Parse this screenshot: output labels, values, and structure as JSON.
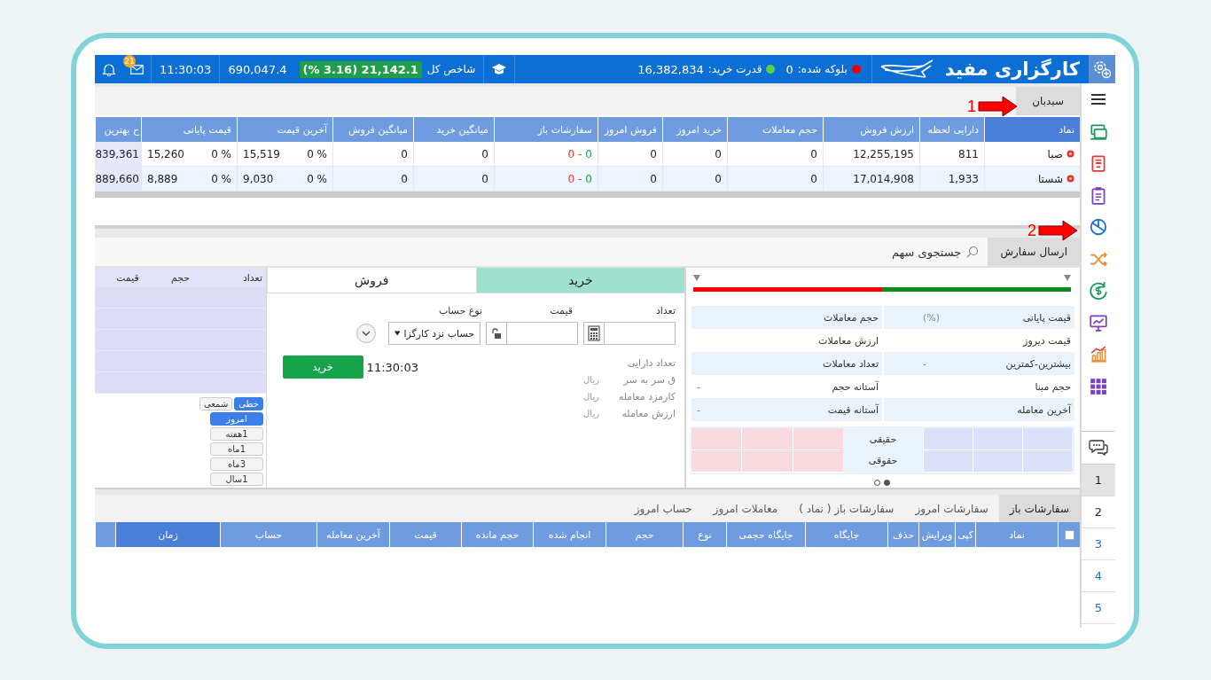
{
  "top_bar": {
    "logo": "کارگزاری مفید",
    "blocked": {
      "label": "بلوکه شده:",
      "value": "0"
    },
    "buying_power": {
      "label": "قدرت خرید:",
      "value": "16,382,834"
    },
    "index": {
      "label": "شاخص کل",
      "change": "(% 3.16) 21,142.1",
      "value": "690,047.4"
    },
    "time": "11:30:03",
    "mail_badge": "21"
  },
  "sidebar": {
    "tabs": [
      {
        "label": "1",
        "selected": true
      },
      {
        "label": "2",
        "selected": false
      },
      {
        "label": "3",
        "selected": false
      },
      {
        "label": "4",
        "selected": false
      },
      {
        "label": "5",
        "selected": false
      }
    ]
  },
  "watchlist": {
    "tabs": [
      {
        "label": "سبدبان",
        "selected": true
      }
    ],
    "columns": [
      {
        "label": "نماد",
        "kind": "symbol",
        "highlighted": true
      },
      {
        "label": "دارایی لحظه",
        "kind": "number",
        "highlighted": false
      },
      {
        "label": "ارزش فروش",
        "kind": "number",
        "highlighted": false
      },
      {
        "label": "حجم معاملات",
        "kind": "number",
        "highlighted": false
      },
      {
        "label": "خرید امروز",
        "kind": "number",
        "highlighted": false
      },
      {
        "label": "فروش امروز",
        "kind": "number",
        "highlighted": false
      },
      {
        "label": "سفارشات باز",
        "kind": "orders",
        "highlighted": false
      },
      {
        "label": "میانگین خرید",
        "kind": "number",
        "highlighted": false
      },
      {
        "label": "میانگین فروش",
        "kind": "number",
        "highlighted": false
      },
      {
        "label": "آخرین قیمت",
        "kind": "price",
        "highlighted": false
      },
      {
        "label": "قیمت پایانی",
        "kind": "price",
        "highlighted": false
      },
      {
        "label": "ح بهترین",
        "kind": "edge",
        "highlighted": false
      }
    ],
    "rows": [
      {
        "cells": [
          "صبا",
          "811",
          "12,255,195",
          "0",
          "0",
          "0",
          {
            "buy": "0",
            "separator": "-",
            "sell": "0"
          },
          "0",
          "0",
          {
            "percent": "0 %",
            "price": "15,519"
          },
          {
            "percent": "0 %",
            "price": "15,260"
          },
          "839,361"
        ]
      },
      {
        "cells": [
          "شستا",
          "1,933",
          "17,014,908",
          "0",
          "0",
          "0",
          {
            "buy": "0",
            "separator": "-",
            "sell": "0"
          },
          "0",
          "0",
          {
            "percent": "0 %",
            "price": "9,030"
          },
          {
            "percent": "0 %",
            "price": "8,889"
          },
          "889,660"
        ]
      }
    ]
  },
  "order_panel": {
    "tabs": [
      {
        "label": "ارسال سفارش",
        "selected": true
      }
    ],
    "search": {
      "placeholder": "جستجوی سهم"
    },
    "balance_bar": {
      "level": 0.5
    },
    "info": [
      {
        "right": {
          "label": "قیمت پایانی",
          "value": "(%)"
        },
        "left": {
          "label": "حجم معاملات"
        }
      },
      {
        "right": {
          "label": "قیمت دیروز"
        },
        "left": {
          "label": "ارزش معاملات"
        }
      },
      {
        "right": {
          "label": "بیشترین-کمترین",
          "value": "-"
        },
        "left": {
          "label": "تعداد معاملات"
        }
      },
      {
        "right": {
          "label": "حجم مبنا"
        },
        "left": {
          "label": "آستانه حجم",
          "value": "-"
        }
      },
      {
        "right": {
          "label": "آخرین معامله"
        },
        "left": {
          "label": "آستانه قیمت",
          "value": "-"
        }
      }
    ],
    "shareholders": [
      "حقیقی",
      "حقوقی"
    ],
    "pager": [
      {
        "selected": true
      },
      {
        "selected": false
      }
    ],
    "form": {
      "sides": [
        {
          "label": "خرید",
          "selected": true
        },
        {
          "label": "فروش",
          "selected": false
        }
      ],
      "quantity_label": "تعداد",
      "price_label": "قیمت",
      "account_label": "نوع حساب",
      "account_value": "حساب نزد کارگزا",
      "summary": [
        {
          "label": "تعداد دارایی"
        },
        {
          "label": "ق سر به سر",
          "unit": "ریال"
        },
        {
          "label": "کارمزد معامله",
          "unit": "ریال"
        },
        {
          "label": "ارزش معامله",
          "unit": "ریال"
        }
      ],
      "time": "11:30:03",
      "submit": "خرید"
    },
    "order_book": {
      "columns": [
        "تعداد",
        "حجم",
        "قیمت"
      ],
      "chart_types": [
        {
          "label": "خطی",
          "selected": true
        },
        {
          "label": "شمعی",
          "selected": false
        }
      ],
      "ranges": [
        {
          "label": "امروز",
          "selected": true
        },
        {
          "label": "1هفته",
          "selected": false
        },
        {
          "label": "1ماه",
          "selected": false
        },
        {
          "label": "3ماه",
          "selected": false
        },
        {
          "label": "1سال",
          "selected": false
        }
      ]
    }
  },
  "orders": {
    "tabs": [
      {
        "label": "سفارشات باز",
        "selected": true
      },
      {
        "label": "سفارشات امروز",
        "selected": false
      },
      {
        "label": "سفارشات باز ( نماد )",
        "selected": false
      },
      {
        "label": "معاملات امروز",
        "selected": false
      },
      {
        "label": "حساب امروز",
        "selected": false
      }
    ],
    "select_all": {
      "checked": false
    },
    "columns": [
      {
        "label": "نماد",
        "highlighted": false
      },
      {
        "label": "کپی",
        "highlighted": false
      },
      {
        "label": "ویرایش",
        "highlighted": false
      },
      {
        "label": "حذف",
        "highlighted": false
      },
      {
        "label": "جایگاه",
        "highlighted": false
      },
      {
        "label": "جایگاه حجمی",
        "highlighted": false
      },
      {
        "label": "نوع",
        "highlighted": false
      },
      {
        "label": "حجم",
        "highlighted": false
      },
      {
        "label": "انجام شده",
        "highlighted": false
      },
      {
        "label": "حجم مانده",
        "highlighted": false
      },
      {
        "label": "قیمت",
        "highlighted": false
      },
      {
        "label": "آخرین معامله",
        "highlighted": false
      },
      {
        "label": "حساب",
        "highlighted": false
      },
      {
        "label": "زمان",
        "highlighted": true
      }
    ]
  },
  "annotations": [
    {
      "number": "1"
    },
    {
      "number": "2"
    }
  ]
}
